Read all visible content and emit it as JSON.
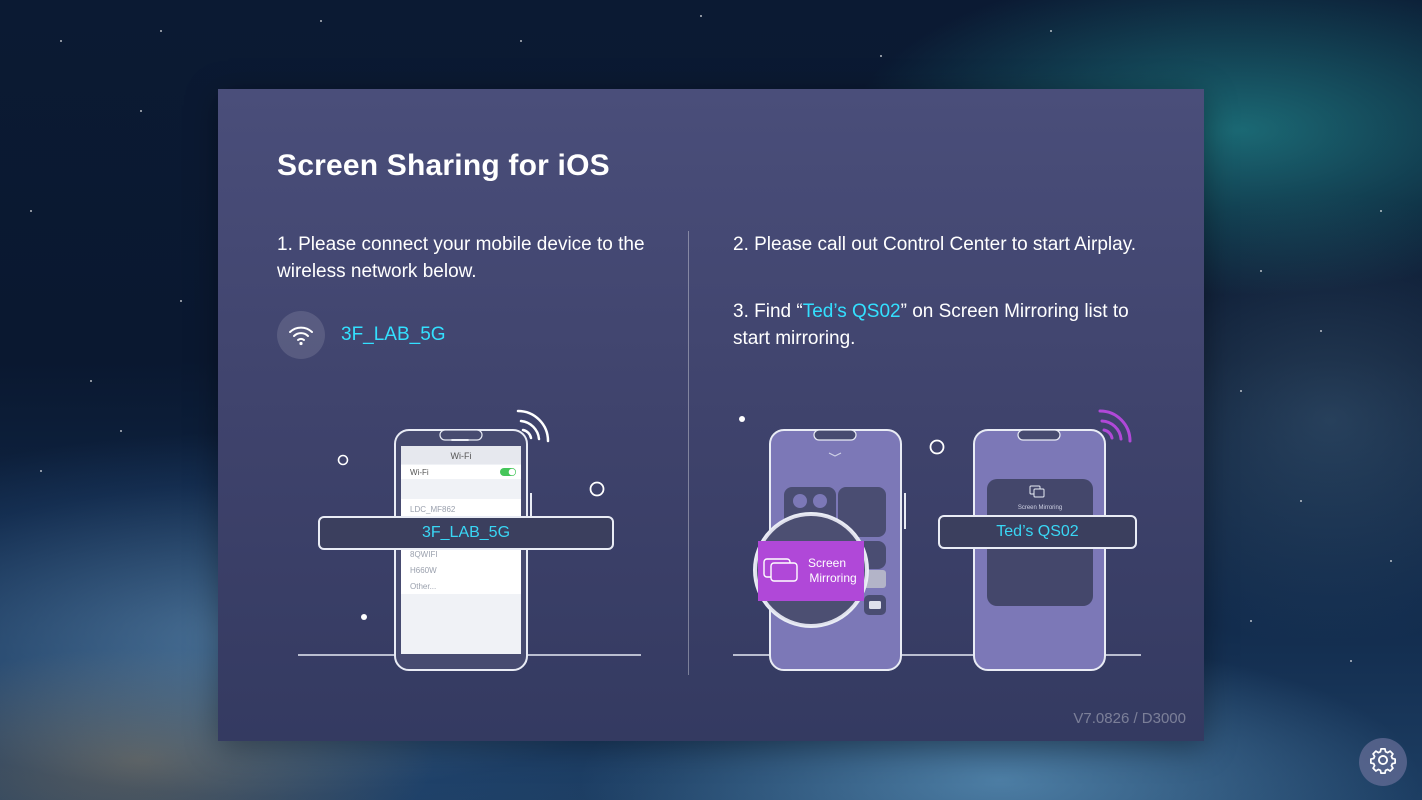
{
  "title": "Screen Sharing for iOS",
  "step1": "1. Please connect your mobile device to the wireless network below.",
  "wifi": {
    "ssid": "3F_LAB_5G",
    "icon": "wifi-icon"
  },
  "step2": "2. Please call out Control Center to start Airplay.",
  "step3": {
    "prefix": "3. Find “",
    "device": "Ted’s QS02",
    "suffix": "” on Screen Mirroring list to start mirroring."
  },
  "phone1": {
    "header": "Wi-Fi",
    "toggle_label": "Wi-Fi",
    "networks": [
      "LDC_MF862",
      "8QWIFI",
      "H660W",
      "Other..."
    ],
    "ssid_label": "3F_LAB_5G"
  },
  "phone2": {
    "mirroring_label_line1": "Screen",
    "mirroring_label_line2": "Mirroring"
  },
  "phone3": {
    "mirroring_title": "Screen Mirroring",
    "device_label": "Ted’s QS02"
  },
  "version": "V7.0826 / D3000",
  "settings_icon": "gear-icon",
  "colors": {
    "accent": "#33e0ff",
    "purple": "#b048d8",
    "panel": "#42476f"
  }
}
